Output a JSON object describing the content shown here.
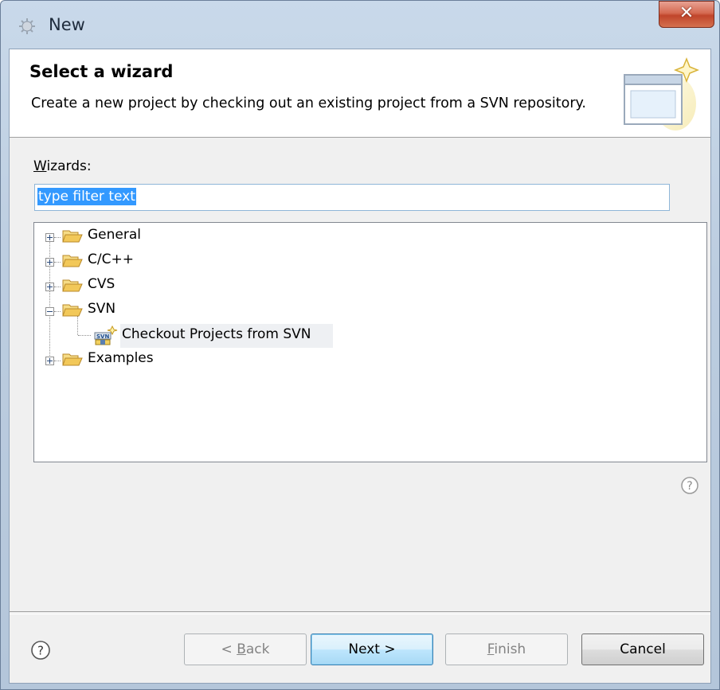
{
  "window": {
    "title": "New"
  },
  "header": {
    "title": "Select a wizard",
    "description": "Create a new project by checking out an existing project from a SVN repository."
  },
  "wizards": {
    "label_mnemonic": "W",
    "label_rest": "izards:",
    "filter_value": "type filter text"
  },
  "tree": {
    "items": [
      {
        "label": "General",
        "expanded": false
      },
      {
        "label": "C/C++",
        "expanded": false
      },
      {
        "label": "CVS",
        "expanded": false
      },
      {
        "label": "SVN",
        "expanded": true,
        "children": [
          {
            "label": "Checkout Projects from SVN",
            "selected": true
          }
        ]
      },
      {
        "label": "Examples",
        "expanded": false
      }
    ]
  },
  "buttons": {
    "back_prefix": "< ",
    "back_mnemonic": "B",
    "back_rest": "ack",
    "next_label": "Next >",
    "finish_mnemonic": "F",
    "finish_rest": "inish",
    "cancel_label": "Cancel"
  },
  "icons": {
    "app": "eclipse-app-icon",
    "close": "close-icon",
    "folder": "folder-icon",
    "help": "help-icon",
    "svn": "svn-checkout-icon",
    "wizard_banner": "new-wizard-icon"
  },
  "colors": {
    "selection": "#3399ff",
    "folder": "#e8c25a",
    "close_button": "#c75a44",
    "default_button": "#bee6fd"
  }
}
